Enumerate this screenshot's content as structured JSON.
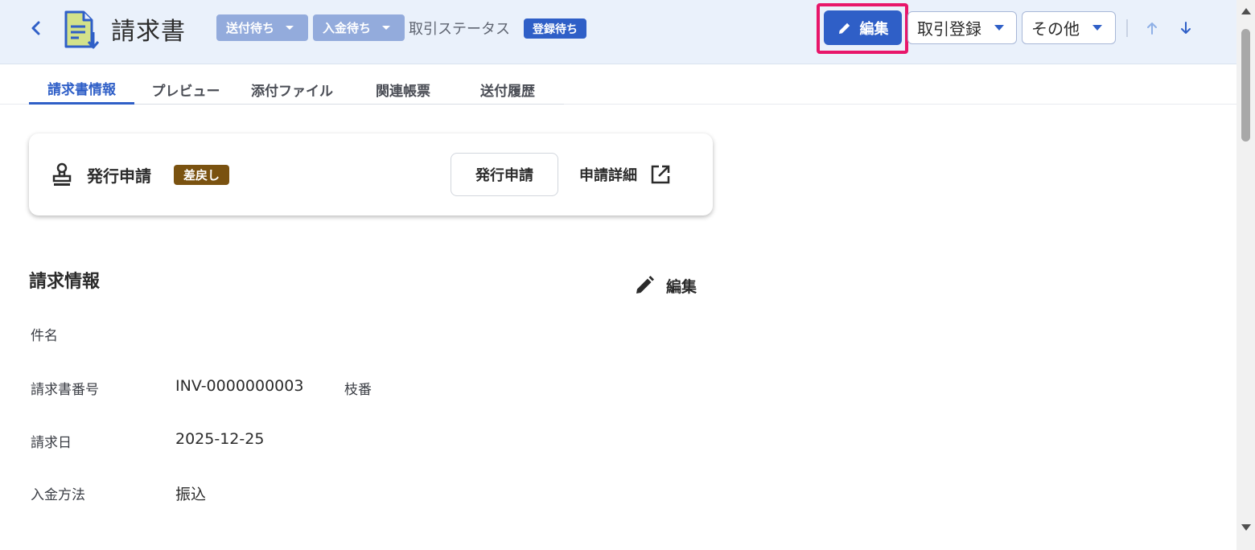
{
  "header": {
    "title": "請求書",
    "chips": [
      {
        "label": "送付待ち"
      },
      {
        "label": "入金待ち"
      }
    ],
    "status_label": "取引ステータス",
    "status_badge": "登録待ち",
    "edit_button": "編集",
    "deal_register_button": "取引登録",
    "other_button": "その他"
  },
  "tabs": [
    {
      "label": "請求書情報",
      "active": true
    },
    {
      "label": "プレビュー"
    },
    {
      "label": "添付ファイル"
    },
    {
      "label": "関連帳票"
    },
    {
      "label": "送付履歴"
    }
  ],
  "approval_card": {
    "title": "発行申請",
    "badge": "差戻し",
    "action_button": "発行申請",
    "detail_link": "申請詳細"
  },
  "invoice_info": {
    "section_title": "請求情報",
    "edit_label": "編集",
    "fields": {
      "subject_label": "件名",
      "subject_value": "",
      "number_label": "請求書番号",
      "number_value": "INV-0000000003",
      "branch_label": "枝番",
      "date_label": "請求日",
      "date_value": "2025-12-25",
      "payment_label": "入金方法",
      "payment_value": "振込"
    }
  },
  "colors": {
    "primary": "#2f5fc7",
    "chip": "#93abdc",
    "header_bg": "#eaf1fb",
    "highlight": "#e8166a",
    "badge_returned": "#7a5210"
  }
}
